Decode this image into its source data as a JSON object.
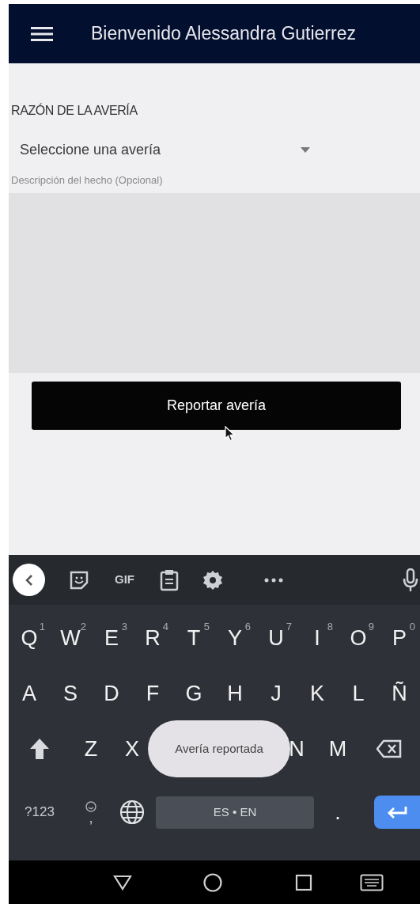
{
  "app_bar": {
    "title": "Bienvenido Alessandra Gutierrez"
  },
  "form": {
    "section_label": "RAZÓN DE LA AVERÍA",
    "dropdown": {
      "placeholder": "Seleccione una avería"
    },
    "description_label": "Descripción del hecho (Opcional)",
    "submit_label": "Reportar avería"
  },
  "keyboard": {
    "toolbar": [
      {
        "kind": "back"
      },
      {
        "kind": "sticker"
      },
      {
        "kind": "text",
        "label": "GIF"
      },
      {
        "kind": "clipboard"
      },
      {
        "kind": "settings"
      },
      {
        "kind": "more"
      },
      {
        "kind": "mic"
      }
    ],
    "rows": [
      {
        "keys": [
          {
            "kind": "letter",
            "label": "Q",
            "hint": "1"
          },
          {
            "kind": "letter",
            "label": "W",
            "hint": "2"
          },
          {
            "kind": "letter",
            "label": "E",
            "hint": "3"
          },
          {
            "kind": "letter",
            "label": "R",
            "hint": "4"
          },
          {
            "kind": "letter",
            "label": "T",
            "hint": "5"
          },
          {
            "kind": "letter",
            "label": "Y",
            "hint": "6"
          },
          {
            "kind": "letter",
            "label": "U",
            "hint": "7"
          },
          {
            "kind": "letter",
            "label": "I",
            "hint": "8"
          },
          {
            "kind": "letter",
            "label": "O",
            "hint": "9"
          },
          {
            "kind": "letter",
            "label": "P",
            "hint": "0"
          }
        ]
      },
      {
        "keys": [
          {
            "kind": "letter",
            "label": "A"
          },
          {
            "kind": "letter",
            "label": "S"
          },
          {
            "kind": "letter",
            "label": "D"
          },
          {
            "kind": "letter",
            "label": "F"
          },
          {
            "kind": "letter",
            "label": "G"
          },
          {
            "kind": "letter",
            "label": "H"
          },
          {
            "kind": "letter",
            "label": "J"
          },
          {
            "kind": "letter",
            "label": "K"
          },
          {
            "kind": "letter",
            "label": "L"
          },
          {
            "kind": "letter",
            "label": "Ñ"
          }
        ]
      },
      {
        "keys": [
          {
            "kind": "shift"
          },
          {
            "kind": "letter",
            "label": "Z"
          },
          {
            "kind": "letter",
            "label": "X"
          },
          {
            "kind": "letter",
            "label": "N"
          },
          {
            "kind": "letter",
            "label": "M"
          },
          {
            "kind": "backspace"
          }
        ]
      },
      {
        "keys": [
          {
            "kind": "symbols",
            "label": "?123"
          },
          {
            "kind": "emoji",
            "label": ","
          },
          {
            "kind": "globe"
          },
          {
            "kind": "space",
            "label": "ES • EN"
          },
          {
            "kind": "letter",
            "label": "."
          },
          {
            "kind": "enter"
          }
        ]
      }
    ],
    "toast": "Avería reportada"
  }
}
